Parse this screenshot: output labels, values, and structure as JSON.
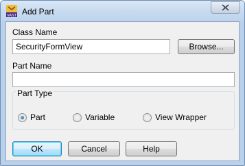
{
  "window": {
    "title": "Add Part",
    "icon": "vast-app-icon",
    "close_icon": "close-icon"
  },
  "form": {
    "class_name_label": "Class Name",
    "class_name_value": "SecurityFormView",
    "browse_label": "Browse...",
    "part_name_label": "Part Name",
    "part_name_value": ""
  },
  "part_type": {
    "legend": "Part Type",
    "options": [
      {
        "label": "Part",
        "selected": true
      },
      {
        "label": "Variable",
        "selected": false
      },
      {
        "label": "View Wrapper",
        "selected": false
      }
    ]
  },
  "buttons": {
    "ok_label": "OK",
    "cancel_label": "Cancel",
    "help_label": "Help"
  },
  "colors": {
    "frame": "#b9d1ea",
    "client": "#f0f0f0",
    "radio_selected": "#1a4f9b"
  }
}
